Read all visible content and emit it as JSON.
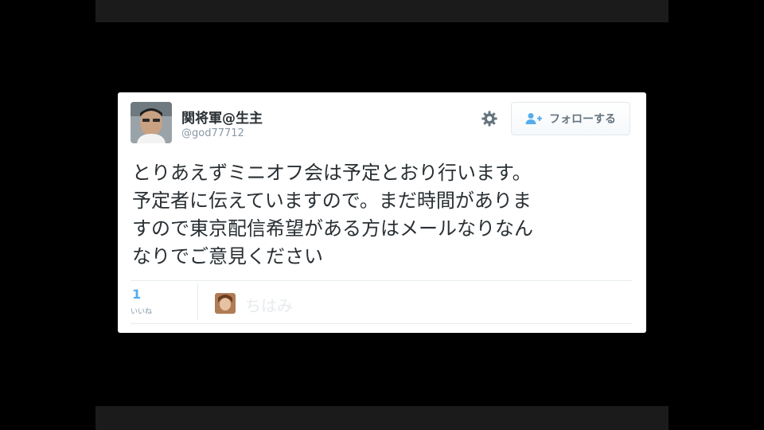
{
  "tweet": {
    "user": {
      "name": "関将軍@生主",
      "handle": "@god77712",
      "avatar_icon": "user-avatar"
    },
    "actions": {
      "settings_icon": "gear-icon",
      "follow_icon": "person-plus-icon",
      "follow_label": "フォローする"
    },
    "text_lines": [
      "とりあえずミニオフ会は予定とおり行います。",
      "予定者に伝えていますので。まだ時間がありま",
      "すので東京配信希望がある方はメールなりなん",
      "なりでご意見ください"
    ],
    "stats": {
      "like_count": "1",
      "like_label": "いいね"
    },
    "likers": [
      {
        "name": "ちはみ",
        "avatar_icon": "user-avatar"
      }
    ]
  },
  "colors": {
    "background": "#000000",
    "card": "#ffffff",
    "text": "#292f33",
    "muted": "#8899a6",
    "accent": "#55acee"
  }
}
